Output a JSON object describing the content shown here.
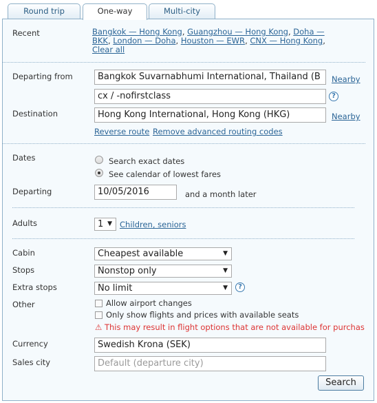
{
  "tabs": {
    "round_trip": "Round trip",
    "one_way": "One-way",
    "multi_city": "Multi-city"
  },
  "recent": {
    "label": "Recent",
    "items": [
      "Bangkok — Hong Kong",
      "Guangzhou — Hong Kong",
      "Doha — BKK",
      "London — Doha",
      "Houston — EWR",
      "CNX — Hong Kong"
    ],
    "clear": "Clear all"
  },
  "route": {
    "departing_label": "Departing from",
    "departing_value": "Bangkok Suvarnabhumi International, Thailand (B",
    "nearby": "Nearby",
    "routing_value": "cx / -nofirstclass",
    "destination_label": "Destination",
    "destination_value": "Hong Kong International, Hong Kong (HKG)",
    "reverse": "Reverse route",
    "remove_codes": "Remove advanced routing codes"
  },
  "dates": {
    "label": "Dates",
    "exact": "Search exact dates",
    "calendar": "See calendar of lowest fares",
    "selected": "calendar",
    "departing_label": "Departing",
    "departing_value": "10/05/2016",
    "later": "and a month later"
  },
  "adults": {
    "label": "Adults",
    "value": "1",
    "children": "Children, seniors"
  },
  "options": {
    "cabin_label": "Cabin",
    "cabin_value": "Cheapest available",
    "stops_label": "Stops",
    "stops_value": "Nonstop only",
    "extra_label": "Extra stops",
    "extra_value": "No limit",
    "other_label": "Other",
    "allow_changes": "Allow airport changes",
    "only_available": "Only show flights and prices with available seats",
    "warning": "This may result in flight options that are not available for purchas"
  },
  "currency": {
    "label": "Currency",
    "value": "Swedish Krona (SEK)"
  },
  "sales": {
    "label": "Sales city",
    "placeholder": "Default (departure city)"
  },
  "search": "Search",
  "icons": {
    "help": "?",
    "dropdown": "▼",
    "warning": "⚠"
  },
  "colors": {
    "link": "#2a6496",
    "warning": "#dd3333",
    "border": "#8fb0c8"
  }
}
